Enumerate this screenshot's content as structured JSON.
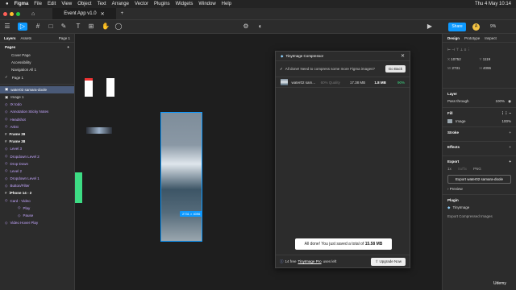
{
  "menubar": {
    "app": "Figma",
    "items": [
      "File",
      "Edit",
      "View",
      "Object",
      "Text",
      "Arrange",
      "Vector",
      "Plugins",
      "Widgets",
      "Window",
      "Help"
    ],
    "clock": "Thu 4 May  10:14"
  },
  "tab": {
    "title": "Event App v1.0"
  },
  "header_right": {
    "share": "Share",
    "zoom": "9%",
    "avatar": "A"
  },
  "left": {
    "tab_layers": "Layers",
    "tab_assets": "Assets",
    "page_select": "Page 1",
    "pages_label": "Pages",
    "pages": [
      "Cover Page",
      "Accessibility",
      "Navigation All 1",
      "Page 1"
    ],
    "layers": [
      {
        "label": "water02 samara-doole",
        "kind": "image",
        "selected": true
      },
      {
        "label": "Image 1",
        "kind": "image"
      },
      {
        "label": "IX todo",
        "kind": "component"
      },
      {
        "label": "Annotation Sticky Notes",
        "kind": "component"
      },
      {
        "label": "Headshot",
        "kind": "component"
      },
      {
        "label": "Artist",
        "kind": "component"
      },
      {
        "label": "Frame 39",
        "kind": "frame"
      },
      {
        "label": "Frame 38",
        "kind": "frame"
      },
      {
        "label": "Level 3",
        "kind": "component"
      },
      {
        "label": "Dropdown Level 2",
        "kind": "component"
      },
      {
        "label": "Drop Down",
        "kind": "component"
      },
      {
        "label": "Level 2",
        "kind": "component"
      },
      {
        "label": "Dropdown Level 1",
        "kind": "component"
      },
      {
        "label": "Button/Filter",
        "kind": "component"
      },
      {
        "label": "iPhone 14 - 2",
        "kind": "frame"
      },
      {
        "label": "Card - Video",
        "kind": "component"
      },
      {
        "label": "Play",
        "kind": "component",
        "indent": 2
      },
      {
        "label": "Pause",
        "kind": "component",
        "indent": 2
      },
      {
        "label": "Video Hover Play",
        "kind": "component"
      }
    ]
  },
  "canvas": {
    "size_badge": "2731 × 4096"
  },
  "plugin": {
    "title": "TinyImage Compressor",
    "notice": "All done! Need to compress some more Figma images?",
    "go_back": "Go Back",
    "file": {
      "name": "water02 sam...",
      "quality": "60% Quality",
      "before": "17.38 MB",
      "after": "1.8 MB",
      "saved": "90%"
    },
    "toast_prefix": "All done! You just saved a total of ",
    "toast_value": "15.58 MB",
    "footer_prefix": "14 free ",
    "footer_link": "TinyImage Pro",
    "footer_suffix": " uses left",
    "upgrade": "Upgrade Now"
  },
  "right": {
    "tab_design": "Design",
    "tab_prototype": "Prototype",
    "tab_inspect": "Inspect",
    "x_label": "X",
    "x": "10752",
    "y_label": "Y",
    "y": "1119",
    "w_label": "W",
    "w": "2731",
    "h_label": "H",
    "h": "4096",
    "layer_title": "Layer",
    "blend": "Pass through",
    "layer_opacity": "100%",
    "fill_title": "Fill",
    "fill_type": "Image",
    "fill_opacity": "100%",
    "stroke_title": "Stroke",
    "effects_title": "Effects",
    "export_title": "Export",
    "scale": "1x",
    "suffix": "Suffix",
    "format": "PNG",
    "export_button": "Export water02 samara-doole",
    "preview": "Preview",
    "plugin_title": "Plugin",
    "plugin_name": "TinyImage",
    "plugin_action": "Export Compressed Images"
  },
  "watermark": "Udemy",
  "colors": {
    "accent": "#0d99ff",
    "purple": "#c4a6ff"
  }
}
